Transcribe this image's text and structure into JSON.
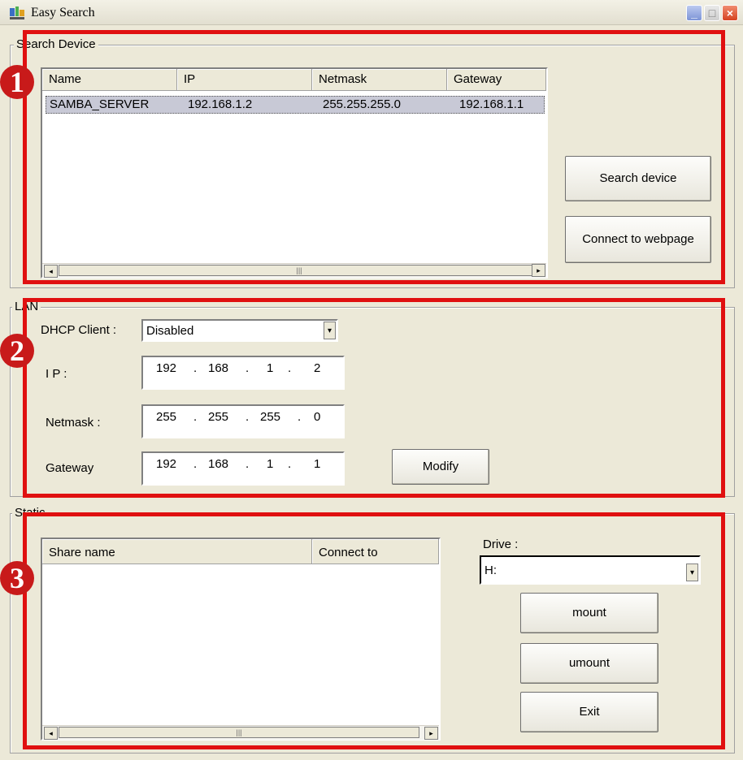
{
  "window": {
    "title": "Easy Search",
    "min_label": "_",
    "max_label": "□",
    "close_label": "×"
  },
  "badges": [
    "1",
    "2",
    "3"
  ],
  "search_device": {
    "legend": "Search Device",
    "columns": [
      "Name",
      "IP",
      "Netmask",
      "Gateway"
    ],
    "rows": [
      {
        "name": "SAMBA_SERVER",
        "ip": "192.168.1.2",
        "netmask": "255.255.255.0",
        "gateway": "192.168.1.1"
      }
    ],
    "search_button": "Search device",
    "connect_button": "Connect to webpage"
  },
  "lan": {
    "legend": "LAN",
    "dhcp_label": "DHCP Client :",
    "dhcp_value": "Disabled",
    "ip_label": "I P :",
    "ip": [
      "192",
      "168",
      "1",
      "2"
    ],
    "netmask_label": "Netmask :",
    "netmask": [
      "255",
      "255",
      "255",
      "0"
    ],
    "gateway_label": "Gateway",
    "gateway": [
      "192",
      "168",
      "1",
      "1"
    ],
    "modify_button": "Modify"
  },
  "static": {
    "legend": "Static",
    "columns": [
      "Share name",
      "Connect to"
    ],
    "drive_label": "Drive :",
    "drive_value": "H:",
    "mount_button": "mount",
    "umount_button": "umount",
    "exit_button": "Exit"
  },
  "colors": {
    "highlight_red": "#e01010",
    "badge_red": "#c81a1a",
    "window_bg": "#ece9d8"
  }
}
